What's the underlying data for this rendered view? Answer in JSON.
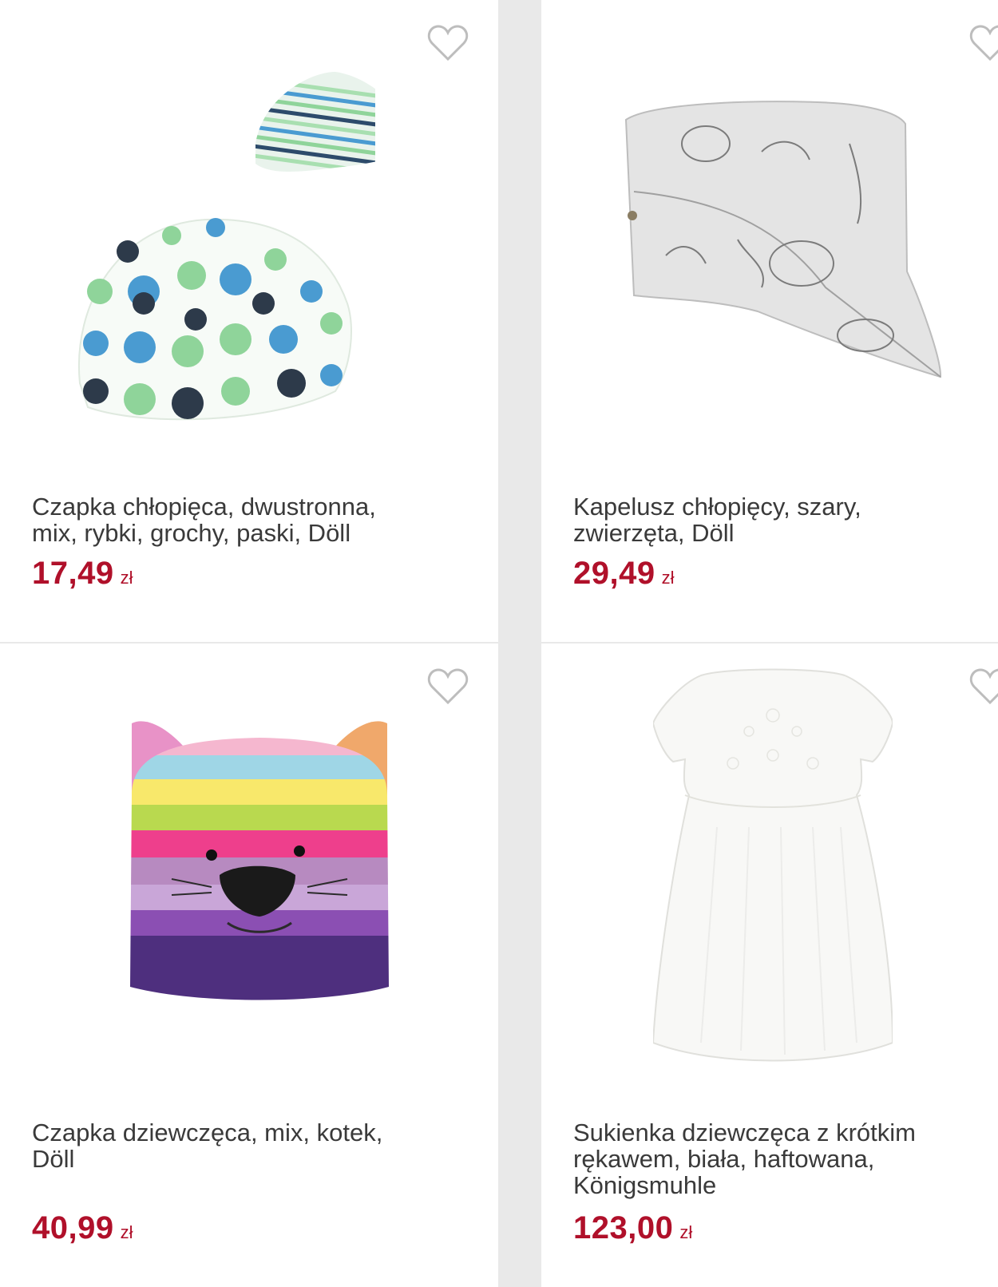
{
  "products": [
    {
      "title": "Czapka chłopięca, dwustronna,\nmix, rybki, grochy, paski, Döll",
      "price": "17,49",
      "currency": "zł"
    },
    {
      "title": "Kapelusz chłopięcy, szary,\nzwierzęta, Döll",
      "price": "29,49",
      "currency": "zł"
    },
    {
      "title": "Czapka dziewczęca, mix, kotek,\nDöll",
      "price": "40,99",
      "currency": "zł"
    },
    {
      "title": "Sukienka dziewczęca z krótkim\nrękawem, biała, haftowana,\nKönigsmuhle",
      "price": "123,00",
      "currency": "zł"
    }
  ],
  "icons": {
    "wishlist": "heart-outline-icon"
  },
  "colors": {
    "price": "#b0102a",
    "background": "#e9e9e9",
    "card": "#ffffff"
  }
}
